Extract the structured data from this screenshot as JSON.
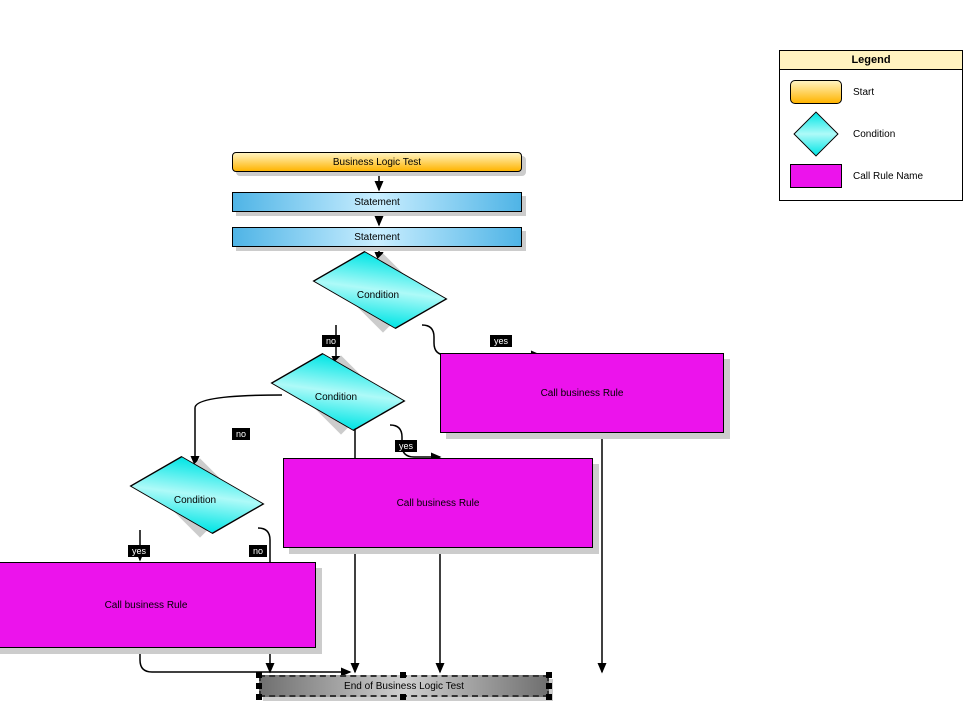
{
  "start": {
    "label": "Business Logic Test"
  },
  "statements": [
    "Statement",
    "Statement"
  ],
  "conditions": {
    "c1": "Condition",
    "c2": "Condition",
    "c3": "Condition"
  },
  "rules": {
    "r1": "Call business Rule",
    "r2": "Call business Rule",
    "r3": "Call business Rule"
  },
  "end": {
    "label": "End of Business Logic Test"
  },
  "edges": {
    "yes": "yes",
    "no": "no"
  },
  "legend": {
    "title": "Legend",
    "start": "Start",
    "condition": "Condition",
    "rule": "Call Rule Name"
  }
}
